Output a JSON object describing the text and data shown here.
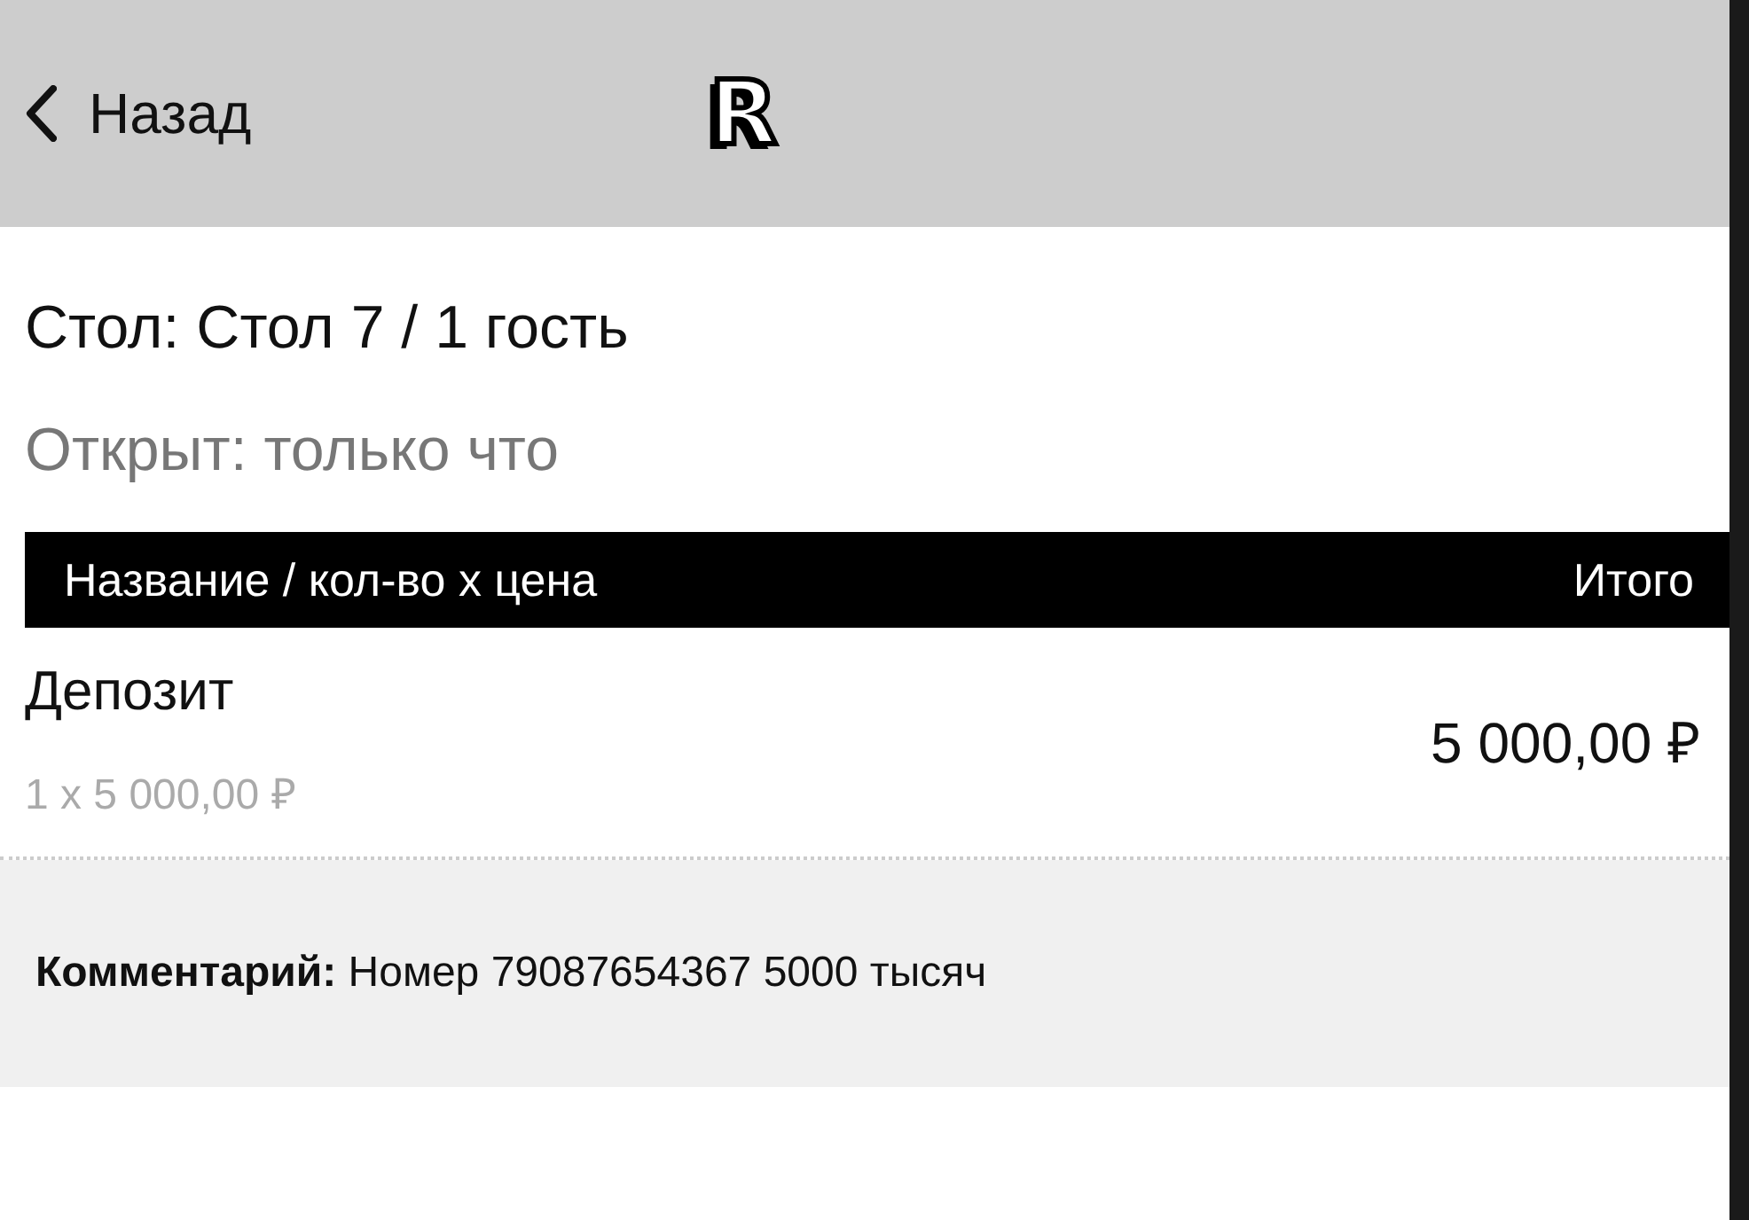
{
  "nav": {
    "back": "Назад",
    "logo": "R"
  },
  "order": {
    "title": "Стол: Стол 7 / 1 гость",
    "opened": "Открыт: только что"
  },
  "table": {
    "columns": [
      "Название / кол-во х цена",
      "Итого"
    ],
    "rows": [
      {
        "name": "Депозит",
        "detail": "1 x 5 000,00 ₽",
        "total": "5 000,00 ₽"
      }
    ]
  },
  "comment": "**Комментарий:** Номер 79087654367 5000 тысяч"
}
